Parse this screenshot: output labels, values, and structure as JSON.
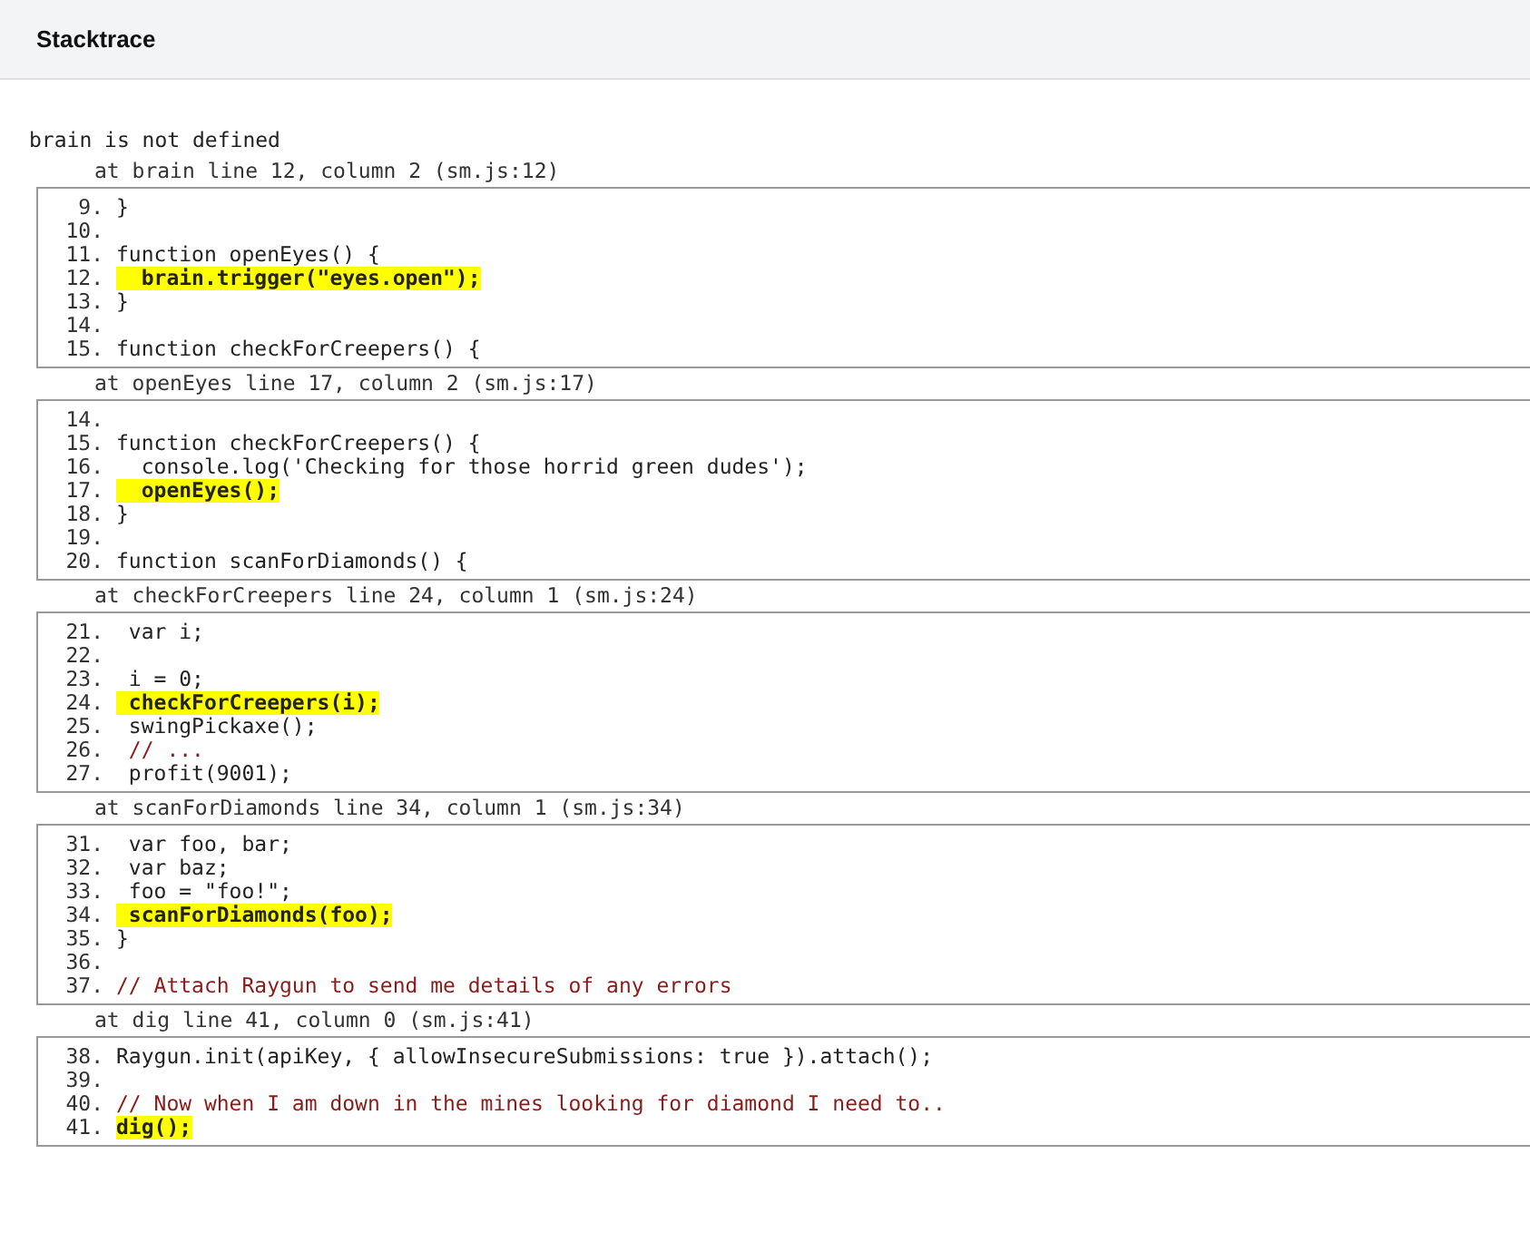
{
  "header": {
    "title": "Stacktrace"
  },
  "error_message": "brain is not defined",
  "frames": [
    {
      "location": "at brain line 12, column 2 (sm.js:12)",
      "lines": [
        {
          "number": "9.",
          "code": "}",
          "highlighted": false,
          "kind": "code"
        },
        {
          "number": "10."
        },
        {
          "number": "11.",
          "code": "function openEyes() {",
          "highlighted": false,
          "kind": "code"
        },
        {
          "number": "12.",
          "code": "  brain.trigger(\"eyes.open\");",
          "highlighted": true,
          "kind": "code"
        },
        {
          "number": "13.",
          "code": "}",
          "highlighted": false,
          "kind": "code"
        },
        {
          "number": "14."
        },
        {
          "number": "15.",
          "code": "function checkForCreepers() {",
          "highlighted": false,
          "kind": "code"
        }
      ]
    },
    {
      "location": "at openEyes line 17, column 2 (sm.js:17)",
      "lines": [
        {
          "number": "14."
        },
        {
          "number": "15.",
          "code": "function checkForCreepers() {",
          "highlighted": false,
          "kind": "code"
        },
        {
          "number": "16.",
          "code": "  console.log('Checking for those horrid green dudes');",
          "highlighted": false,
          "kind": "code"
        },
        {
          "number": "17.",
          "code": "  openEyes();",
          "highlighted": true,
          "kind": "code"
        },
        {
          "number": "18.",
          "code": "}",
          "highlighted": false,
          "kind": "code"
        },
        {
          "number": "19."
        },
        {
          "number": "20.",
          "code": "function scanForDiamonds() {",
          "highlighted": false,
          "kind": "code"
        }
      ]
    },
    {
      "location": "at checkForCreepers line 24, column 1 (sm.js:24)",
      "lines": [
        {
          "number": "21.",
          "code": " var i;",
          "highlighted": false,
          "kind": "code"
        },
        {
          "number": "22."
        },
        {
          "number": "23.",
          "code": " i = 0;",
          "highlighted": false,
          "kind": "code"
        },
        {
          "number": "24.",
          "code": " checkForCreepers(i);",
          "highlighted": true,
          "kind": "code"
        },
        {
          "number": "25.",
          "code": " swingPickaxe();",
          "highlighted": false,
          "kind": "code"
        },
        {
          "number": "26.",
          "code": " // ...",
          "highlighted": false,
          "kind": "comment"
        },
        {
          "number": "27.",
          "code": " profit(9001);",
          "highlighted": false,
          "kind": "code"
        }
      ]
    },
    {
      "location": "at scanForDiamonds line 34, column 1 (sm.js:34)",
      "lines": [
        {
          "number": "31.",
          "code": " var foo, bar;",
          "highlighted": false,
          "kind": "code"
        },
        {
          "number": "32.",
          "code": " var baz;",
          "highlighted": false,
          "kind": "code"
        },
        {
          "number": "33.",
          "code": " foo = \"foo!\";",
          "highlighted": false,
          "kind": "code"
        },
        {
          "number": "34.",
          "code": " scanForDiamonds(foo);",
          "highlighted": true,
          "kind": "code"
        },
        {
          "number": "35.",
          "code": "}",
          "highlighted": false,
          "kind": "code"
        },
        {
          "number": "36."
        },
        {
          "number": "37.",
          "code": "// Attach Raygun to send me details of any errors",
          "highlighted": false,
          "kind": "comment"
        }
      ]
    },
    {
      "location": "at dig line 41, column 0 (sm.js:41)",
      "lines": [
        {
          "number": "38.",
          "code": "Raygun.init(apiKey, { allowInsecureSubmissions: true }).attach();",
          "highlighted": false,
          "kind": "code"
        },
        {
          "number": "39."
        },
        {
          "number": "40.",
          "code": "// Now when I am down in the mines looking for diamond I need to..",
          "highlighted": false,
          "kind": "comment"
        },
        {
          "number": "41.",
          "code": "dig();",
          "highlighted": true,
          "kind": "code"
        }
      ]
    }
  ]
}
